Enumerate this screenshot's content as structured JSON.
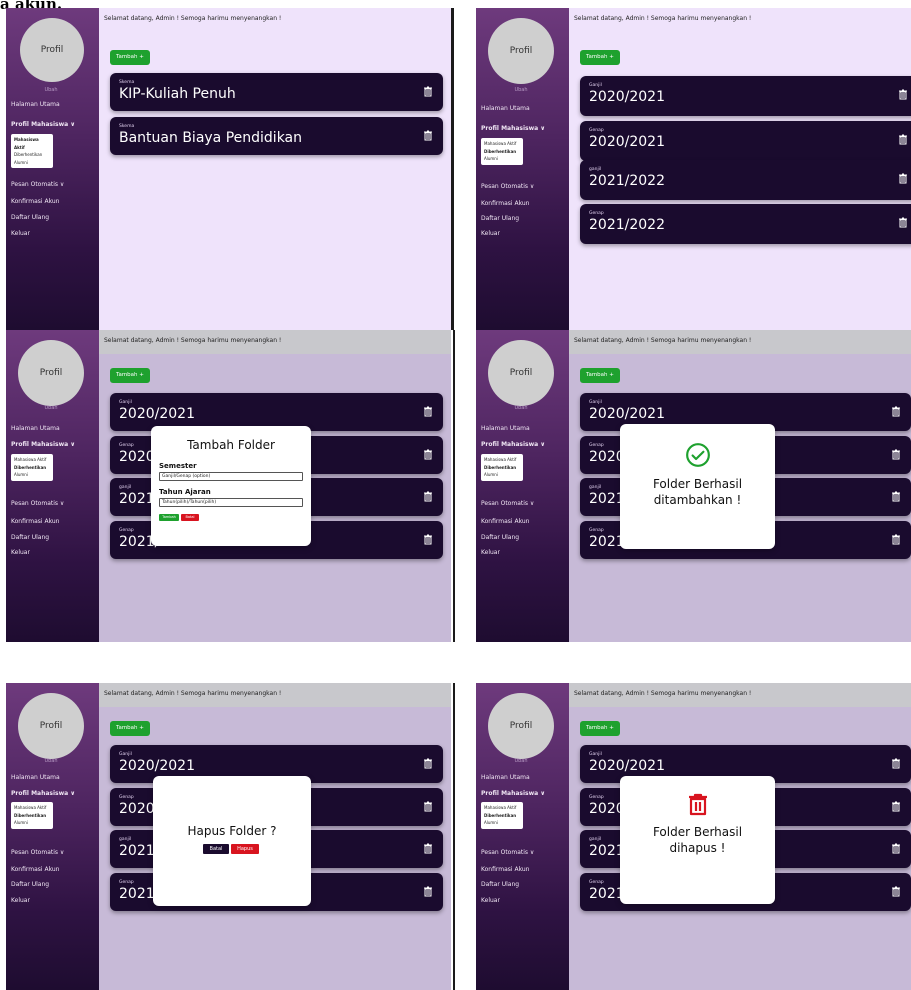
{
  "caption": "a akun.",
  "sidebar": {
    "profile_label": "Profil",
    "change_label": "Ubah",
    "home": "Halaman Utama",
    "student_profile": "Profil Mahasiswa ∨",
    "submenu": [
      "Mahasiswa Aktif",
      "Diberhentikan",
      "Alumni"
    ],
    "auto_message": "Pesan Otomatis  ∨",
    "confirm_account": "Konfirmasi Akun",
    "re_register": "Daftar Ulang",
    "logout": "Keluar"
  },
  "header": {
    "welcome": "Selamat datang, Admin ! Semoga harimu menyenangkan !"
  },
  "add_button": "Tambah +",
  "panel1_cards": [
    {
      "caption": "Skema",
      "value": "KIP-Kuliah Penuh"
    },
    {
      "caption": "Skema",
      "value": "Bantuan Biaya Pendidikan"
    }
  ],
  "semester_cards": [
    {
      "caption": "Ganjil",
      "value": "2020/2021"
    },
    {
      "caption": "Genap",
      "value": "2020/2021"
    },
    {
      "caption": "ganjil",
      "value": "2021/2022"
    },
    {
      "caption": "Genap",
      "value": "2021/2022"
    }
  ],
  "add_folder_modal": {
    "title": "Tambah Folder",
    "semester_label": "Semester",
    "semester_placeholder": "Ganjil/Genap (option)",
    "year_label": "Tahun Ajaran",
    "year_placeholder": "Tahun(pilih)/Tahun(pilih)",
    "submit": "Tambah",
    "cancel": "Batal"
  },
  "success_added_modal": {
    "message": "Folder Berhasil ditambahkan !"
  },
  "delete_confirm_modal": {
    "title": "Hapus Folder ?",
    "cancel": "Batal",
    "confirm": "Hapus"
  },
  "success_deleted_modal": {
    "message": "Folder Berhasil dihapus !"
  },
  "colors": {
    "accent_green": "#1ea12e",
    "danger_red": "#d8141f",
    "card_bg": "#1a0b2e",
    "main_bg": "#efe3fb",
    "dim_bg": "#c7bad7"
  }
}
